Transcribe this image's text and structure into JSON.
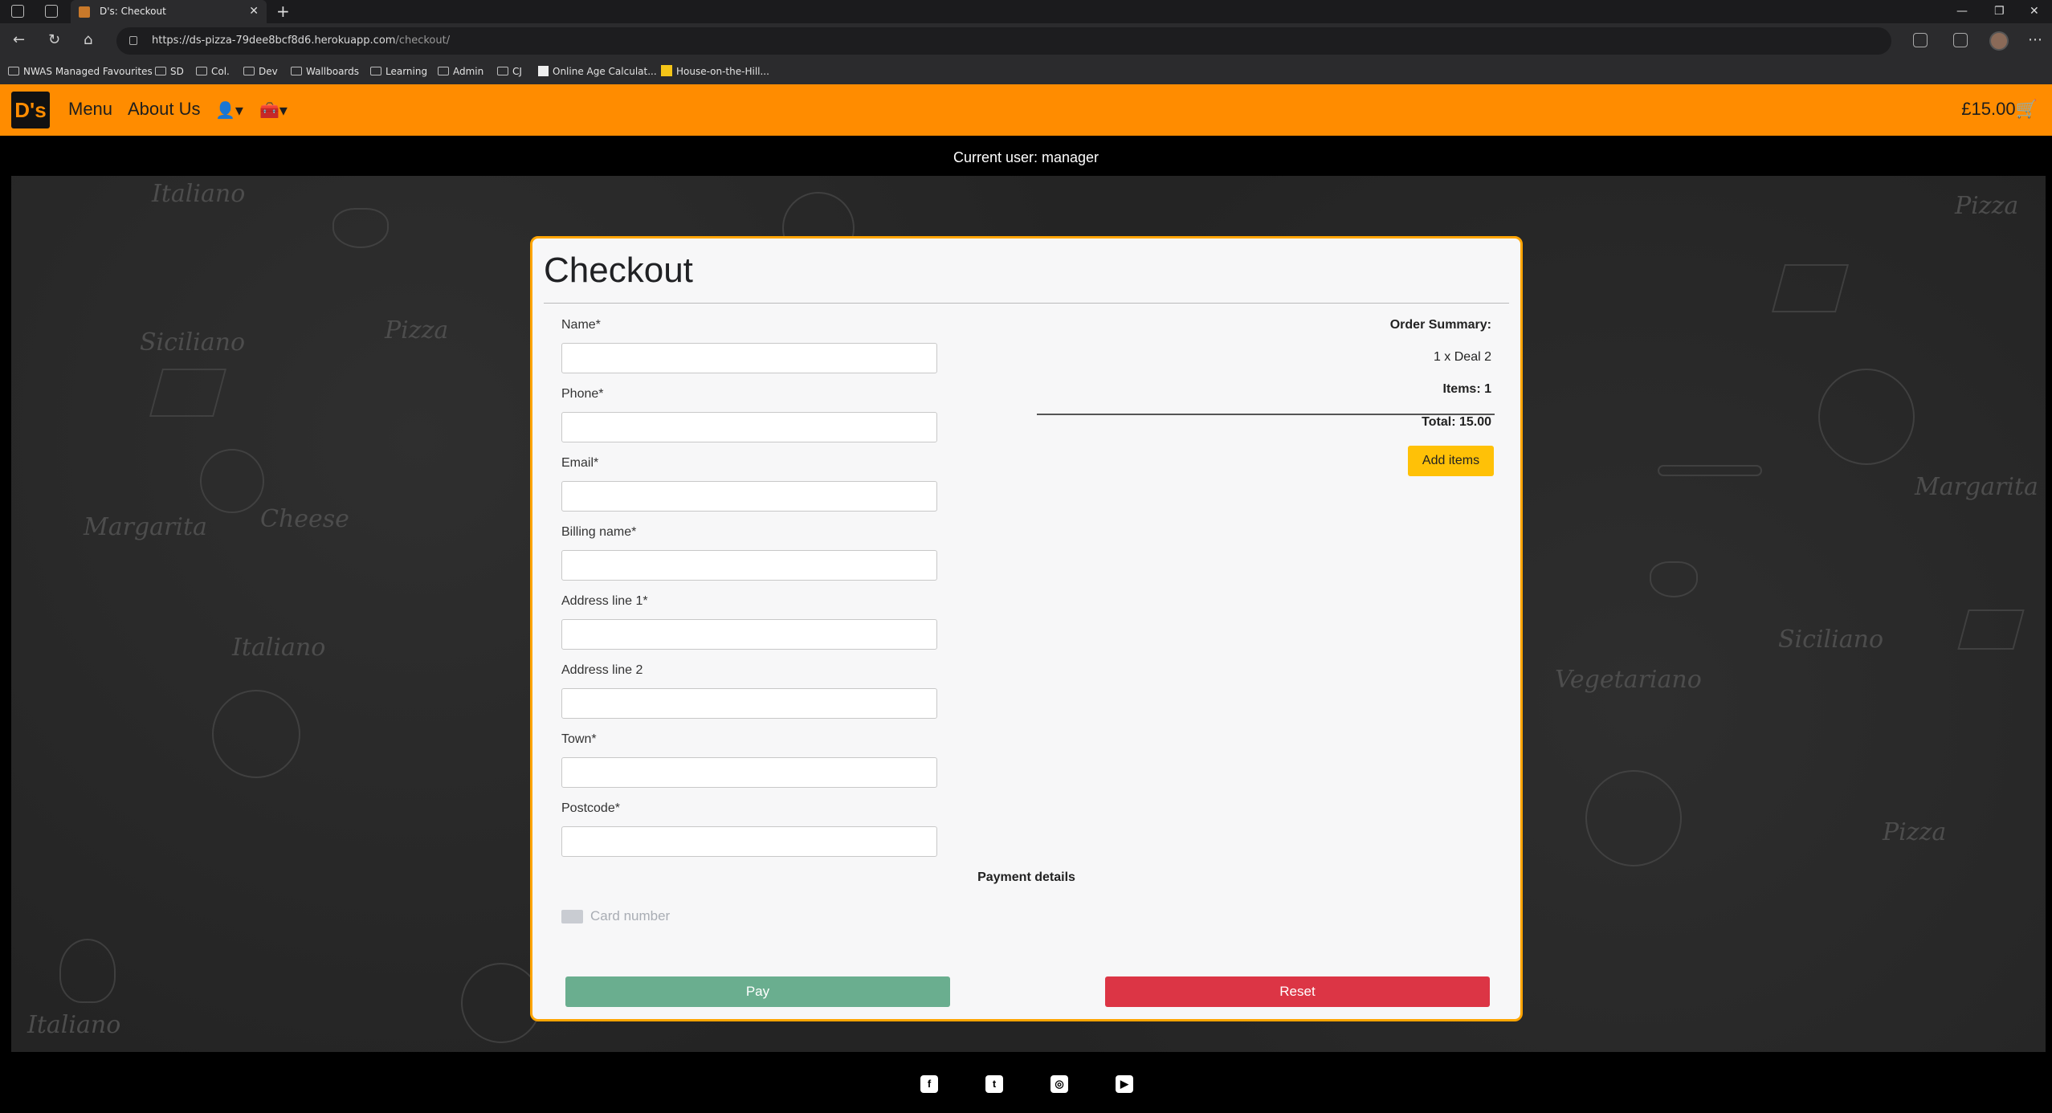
{
  "browser": {
    "tab_title": "D's: Checkout",
    "url_main": "https://ds-pizza-79dee8bcf8d6.herokuapp.com",
    "url_path": "/checkout/",
    "bookmarks": [
      "NWAS Managed Favourites",
      "SD",
      "Col.",
      "Dev",
      "Wallboards",
      "Learning",
      "Admin",
      "CJ",
      "Online Age Calculat...",
      "House-on-the-Hill..."
    ]
  },
  "nav": {
    "logo": "D's",
    "links": [
      "Menu",
      "About Us"
    ],
    "cart_total": "£15.00",
    "brand_color": "#ff8c00"
  },
  "userbar": {
    "text": "Current user: manager"
  },
  "background_words": [
    "Italiano",
    "Pizza",
    "Siciliano",
    "Margarita",
    "Cheese",
    "Vegetariano",
    "Italiano",
    "Pizza",
    "Siciliano",
    "Margarita",
    "Pizza",
    "Italiano"
  ],
  "checkout": {
    "title": "Checkout",
    "fields": [
      {
        "label": "Name*"
      },
      {
        "label": "Phone*"
      },
      {
        "label": "Email*"
      },
      {
        "label": "Billing name*"
      },
      {
        "label": "Address line 1*"
      },
      {
        "label": "Address line 2"
      },
      {
        "label": "Town*"
      },
      {
        "label": "Postcode*"
      }
    ],
    "summary": {
      "heading": "Order Summary:",
      "item": "1 x Deal 2",
      "items_count": "Items: 1",
      "total": "Total: 15.00",
      "add_items": "Add items"
    },
    "payment_heading": "Payment details",
    "card_placeholder": "Card number",
    "pay_label": "Pay",
    "reset_label": "Reset"
  },
  "footer": {
    "icons": [
      "facebook-icon",
      "twitter-icon",
      "instagram-icon",
      "youtube-icon"
    ]
  }
}
